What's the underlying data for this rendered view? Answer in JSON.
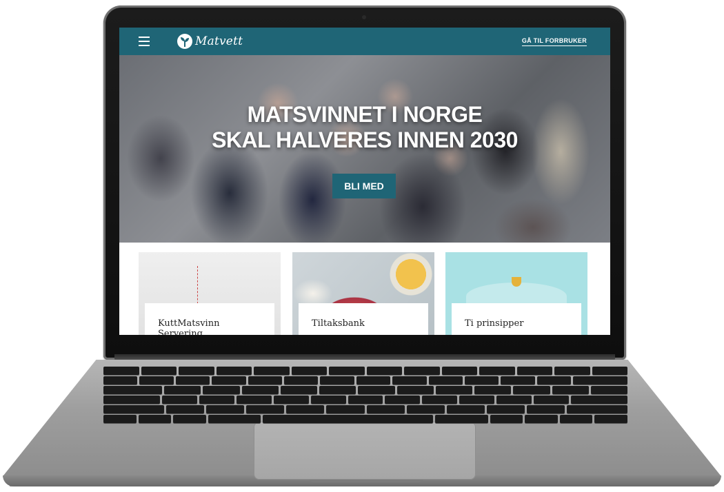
{
  "site": {
    "logo_text": "Matvett",
    "header_link": "GÅ TIL FORBRUKER",
    "accent_color": "#1f6576"
  },
  "hero": {
    "title_line1": "MATSVINNET I NORGE",
    "title_line2": "SKAL HALVERES INNEN 2030",
    "cta_label": "BLI MED"
  },
  "cards": [
    {
      "title_line1": "KuttMatsvinn",
      "title_line2": "Servering"
    },
    {
      "title_line1": "Tiltaksbank"
    },
    {
      "title_line1": "Ti prinsipper"
    }
  ],
  "icons": {
    "menu": "hamburger-menu-icon",
    "logo": "sprout-logo-icon"
  }
}
